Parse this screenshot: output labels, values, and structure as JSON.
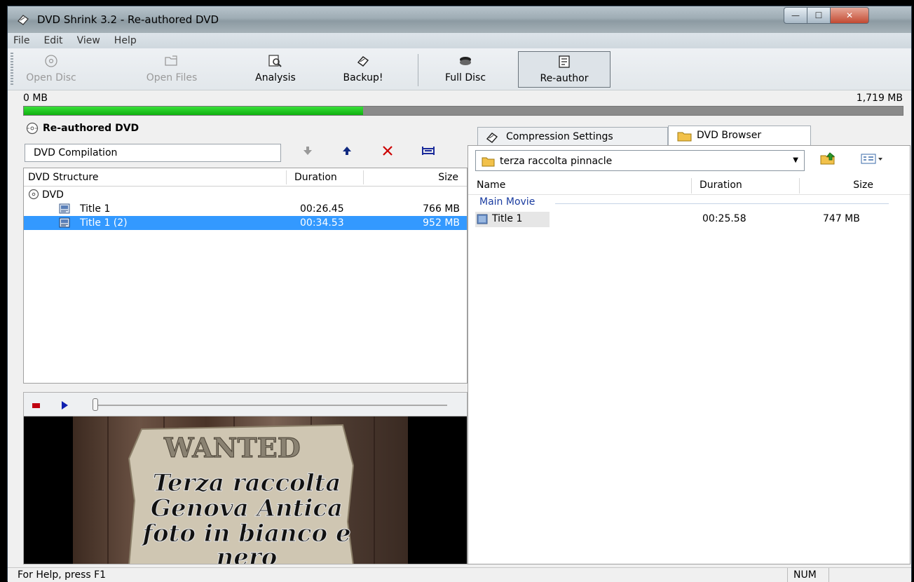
{
  "window": {
    "title": "DVD Shrink 3.2 - Re-authored DVD",
    "controls": {
      "minimize": "—",
      "maximize": "☐",
      "close": "✕"
    }
  },
  "menu": [
    "File",
    "Edit",
    "View",
    "Help"
  ],
  "toolbar": {
    "open_disc": "Open Disc",
    "open_files": "Open Files",
    "analysis": "Analysis",
    "backup": "Backup!",
    "full_disc": "Full Disc",
    "re_author": "Re-author"
  },
  "size_bar": {
    "min": "0 MB",
    "max": "1,719 MB",
    "fill_fraction": 0.386
  },
  "left": {
    "header": "Re-authored DVD",
    "compilation_name": "DVD Compilation",
    "columns": {
      "structure": "DVD Structure",
      "duration": "Duration",
      "size": "Size"
    },
    "tree_root": "DVD",
    "rows": [
      {
        "name": "Title 1",
        "duration": "00:26.45",
        "size": "766 MB",
        "selected": false
      },
      {
        "name": "Title 1 (2)",
        "duration": "00:34.53",
        "size": "952 MB",
        "selected": true
      }
    ]
  },
  "video": {
    "sign_title": "WANTED",
    "lines": [
      "Terza raccolta",
      "Genova Antica",
      "foto in bianco e",
      "nero"
    ]
  },
  "right": {
    "tabs": {
      "compression": "Compression Settings",
      "browser": "DVD Browser"
    },
    "folder": "terza raccolta pinnacle",
    "columns": {
      "name": "Name",
      "duration": "Duration",
      "size": "Size"
    },
    "group": "Main Movie",
    "rows": [
      {
        "name": "Title 1",
        "duration": "00:25.58",
        "size": "747 MB"
      }
    ]
  },
  "status": {
    "message": "For Help, press F1",
    "num": "NUM"
  },
  "colors": {
    "progress": "#22c422",
    "selection": "#3399ff",
    "group_header": "#1a3ca0"
  }
}
